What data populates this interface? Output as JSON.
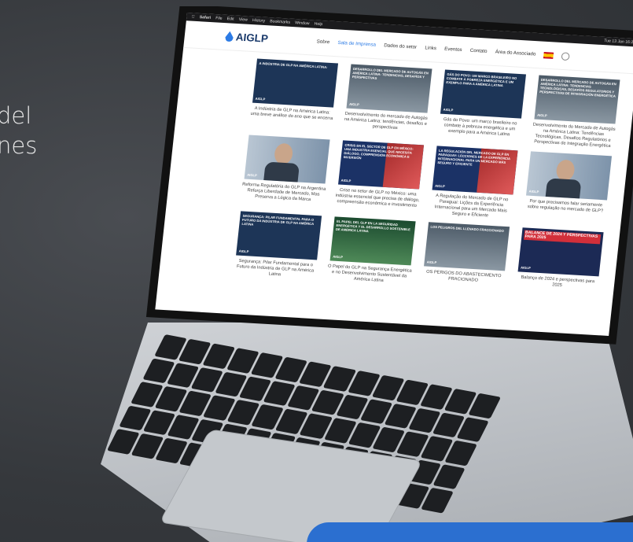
{
  "side_text": [
    "del",
    "nes"
  ],
  "menubar": {
    "app": "Safari",
    "items": [
      "File",
      "Edit",
      "View",
      "History",
      "Bookmarks",
      "Window",
      "Help"
    ],
    "clock": "Tue 13 Jan  16:22"
  },
  "site": {
    "logo": "AIGLP",
    "nav": [
      {
        "label": "Sobre",
        "active": false
      },
      {
        "label": "Sala de Imprensa",
        "active": true
      },
      {
        "label": "Dados do setor",
        "active": false
      },
      {
        "label": "Links",
        "active": false
      },
      {
        "label": "Eventos",
        "active": false
      },
      {
        "label": "Contato",
        "active": false
      },
      {
        "label": "Área do Associado",
        "active": false
      }
    ]
  },
  "cards": [
    {
      "thumb": "A INDÚSTRIA DE GLP NA AMÉRICA LATINA:",
      "style": "blue",
      "caption": "A Indústria de GLP na América Latina: uma breve análise do ano que se encerra"
    },
    {
      "thumb": "DESARROLLO DEL MERCADO DE AUTOGÁS EN AMÉRICA LATINA: TENDENCIAS, DESAFÍOS Y PERSPECTIVAS",
      "style": "grey",
      "caption": "Desenvolvimento do mercado de Autogás na América Latina: tendências, desafios e perspectivas"
    },
    {
      "thumb": "GÁS DO POVO: UM MARCO BRASILEIRO NO COMBATE À POBREZA ENERGÉTICA E UM EXEMPLO PARA A AMÉRICA LATINA",
      "style": "blue",
      "caption": "Gás do Povo: um marco brasileiro no combate à pobreza energética e um exemplo para a América Latina"
    },
    {
      "thumb": "DESARROLLO DEL MERCADO DE AUTOGÁS EN AMÉRICA LATINA: TENDENCIAS TECNOLÓGICAS, DESAFÍOS REGULATORIOS Y PERSPECTIVAS DE INTEGRACIÓN ENERGÉTICA",
      "style": "grey",
      "caption": "Desenvolvimento do Mercado de Autogás na América Latina: Tendências Tecnológicas, Desafios Regulatórios e Perspectivas de Integração Energética"
    },
    {
      "thumb": "",
      "style": "person",
      "caption": "Reforma Regulatória do GLP na Argentina Reforça Liberdade de Mercado, Mas Preserva a Lógica da Marca"
    },
    {
      "thumb": "CRISIS EN EL SECTOR DE GLP EN MÉXICO: UNA INDUSTRIA ESENCIAL QUE NECESITA DIÁLOGO, COMPRENSIÓN ECONÓMICA E INVERSIÓN",
      "style": "red",
      "caption": "Crise no setor de GLP no México: uma indústria essencial que precisa de diálogo, compreensão econômica e investimento"
    },
    {
      "thumb": "LA REGULACIÓN DEL MERCADO DE GLP EN PARAGUAY: LECCIONES DE LA EXPERIENCIA INTERNACIONAL PARA UN MERCADO MÁS SEGURO Y EFICIENTE",
      "style": "red",
      "caption": "A Regulação do Mercado de GLP no Paraguai: Lições da Experiência Internacional para um Mercado Mais Seguro e Eficiente"
    },
    {
      "thumb": "",
      "style": "person",
      "caption": "Por que precisamos falar seriamente sobre regulação no mercado de GLP?"
    },
    {
      "thumb": "SEGURANÇA: PILAR FUNDAMENTAL PARA O FUTURO DA INDÚSTRIA DE GLP NA AMÉRICA LATINA",
      "style": "blue",
      "caption": "Segurança: Pilar Fundamental para o Futuro da Indústria de GLP na América Latina"
    },
    {
      "thumb": "EL PAPEL DEL GLP EN LA SEGURIDAD ENERGÉTICA Y EL DESARROLLO SOSTENIBLE DE AMÉRICA LATINA",
      "style": "green",
      "caption": "O Papel do GLP na Segurança Energética e no Desenvolvimento Sustentável da América Latina"
    },
    {
      "thumb": "LOS PELIGROS DEL LLENADO FRACCIONADO",
      "style": "grey",
      "caption": "OS PERIGOS DO ABASTECIMENTO FRACIONADO"
    },
    {
      "thumb": "BALANCE DE 2024 Y PERSPECTIVAS PARA 2025",
      "style": "balance",
      "caption": "Balanço de 2024 e perspectivas para 2025"
    }
  ],
  "thumb_badge": "AIGLP",
  "colors": {
    "accent": "#2c7be5",
    "navy": "#1a3a6b",
    "background": "#3a3d41",
    "strip": "#2b6fd0"
  }
}
